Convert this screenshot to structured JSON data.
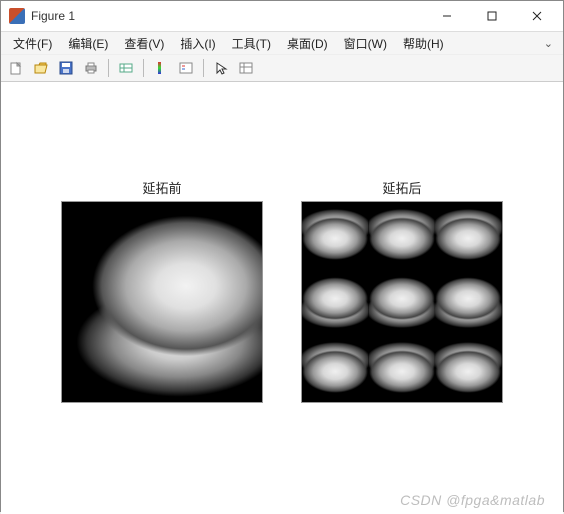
{
  "window": {
    "title": "Figure 1"
  },
  "menu": {
    "file": "文件(F)",
    "edit": "编辑(E)",
    "view": "查看(V)",
    "insert": "插入(I)",
    "tools": "工具(T)",
    "desktop": "桌面(D)",
    "window": "窗口(W)",
    "help": "帮助(H)"
  },
  "toolbar": {
    "new": "new-figure",
    "open": "open",
    "save": "save",
    "print": "print",
    "tile": "link-plot",
    "colorbar": "colorbar",
    "legend": "legend",
    "pointer": "pointer",
    "figpalette": "figure-palette"
  },
  "subplots": {
    "left_title": "延拓前",
    "right_title": "延拓后"
  },
  "watermark": "CSDN @fpga&matlab"
}
